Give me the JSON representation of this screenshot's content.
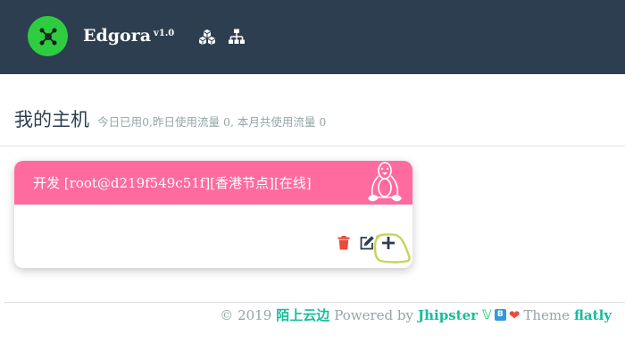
{
  "navbar": {
    "brand": "Edgora",
    "version": "v1.0",
    "icons": [
      "cubes-icon",
      "sitemap-icon"
    ],
    "background": "#2c3e50",
    "logo_color": "#2ecc40"
  },
  "page": {
    "title": "我的主机",
    "subtitle": "今日已用0,昨日使用流量 0,  本月共使用流量 0"
  },
  "host_card": {
    "title": "开发 [root@d219f549c51f][香港节点][在线]",
    "header_color": "#ff6b9e",
    "os_icon": "linux-icon",
    "actions": [
      "delete-icon",
      "edit-icon",
      "add-icon"
    ]
  },
  "footer": {
    "copyright": "© 2019",
    "site_link": "陌上云边",
    "powered_by": "Powered by",
    "jhipster": "Jhipster",
    "theme_text": "Theme",
    "theme_link": "flatly",
    "accent": "#18bc9c"
  }
}
